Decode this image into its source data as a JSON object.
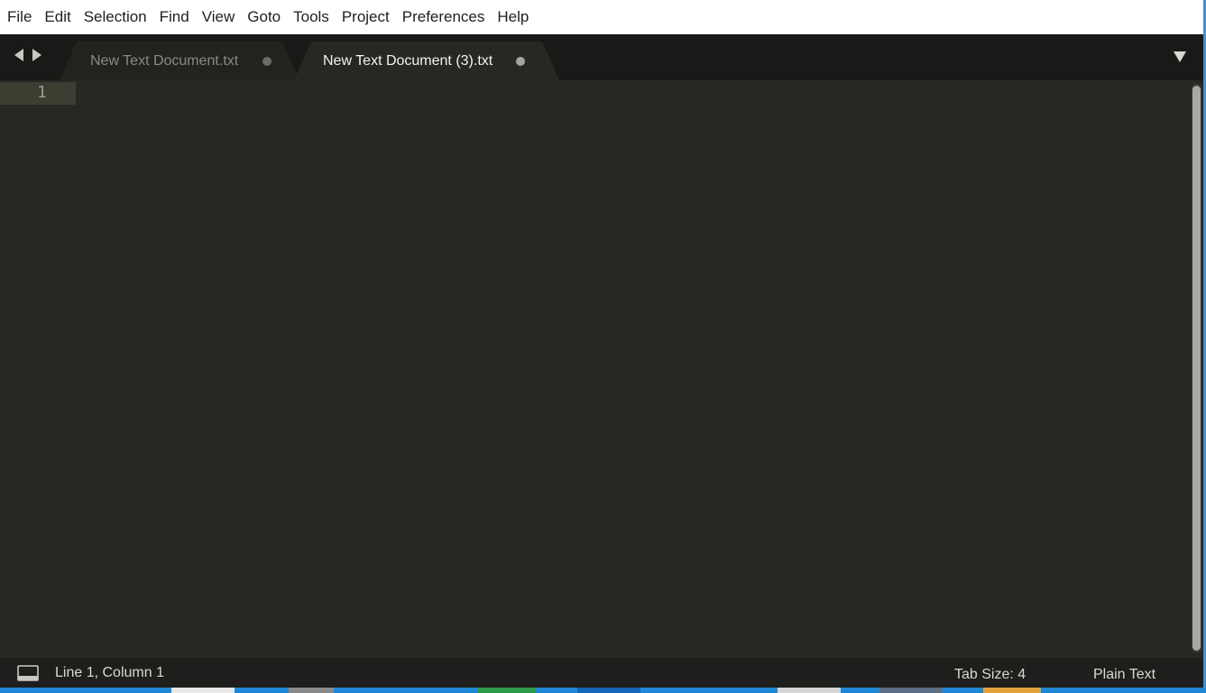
{
  "menubar": {
    "items": [
      "File",
      "Edit",
      "Selection",
      "Find",
      "View",
      "Goto",
      "Tools",
      "Project",
      "Preferences",
      "Help"
    ]
  },
  "tabs": [
    {
      "label": "New Text Document.txt",
      "active": false,
      "modified": true
    },
    {
      "label": "New Text Document (3).txt",
      "active": true,
      "modified": true
    }
  ],
  "editor": {
    "line_numbers": [
      "1"
    ]
  },
  "statusbar": {
    "position": "Line 1, Column 1",
    "tab_size": "Tab Size: 4",
    "syntax": "Plain Text"
  },
  "colors": {
    "editor_bg": "#272822",
    "tabstrip_bg": "#191a17",
    "active_tab_bg": "#272822",
    "inactive_tab_bg": "#22231f",
    "statusbar_bg": "#1e1f1c",
    "taskbar": "#1e88d6"
  },
  "icons": {
    "nav_back": "triangle-left-icon",
    "nav_forward": "triangle-right-icon",
    "tabs_menu": "triangle-down-icon",
    "panel_toggle": "console-panel-icon"
  }
}
